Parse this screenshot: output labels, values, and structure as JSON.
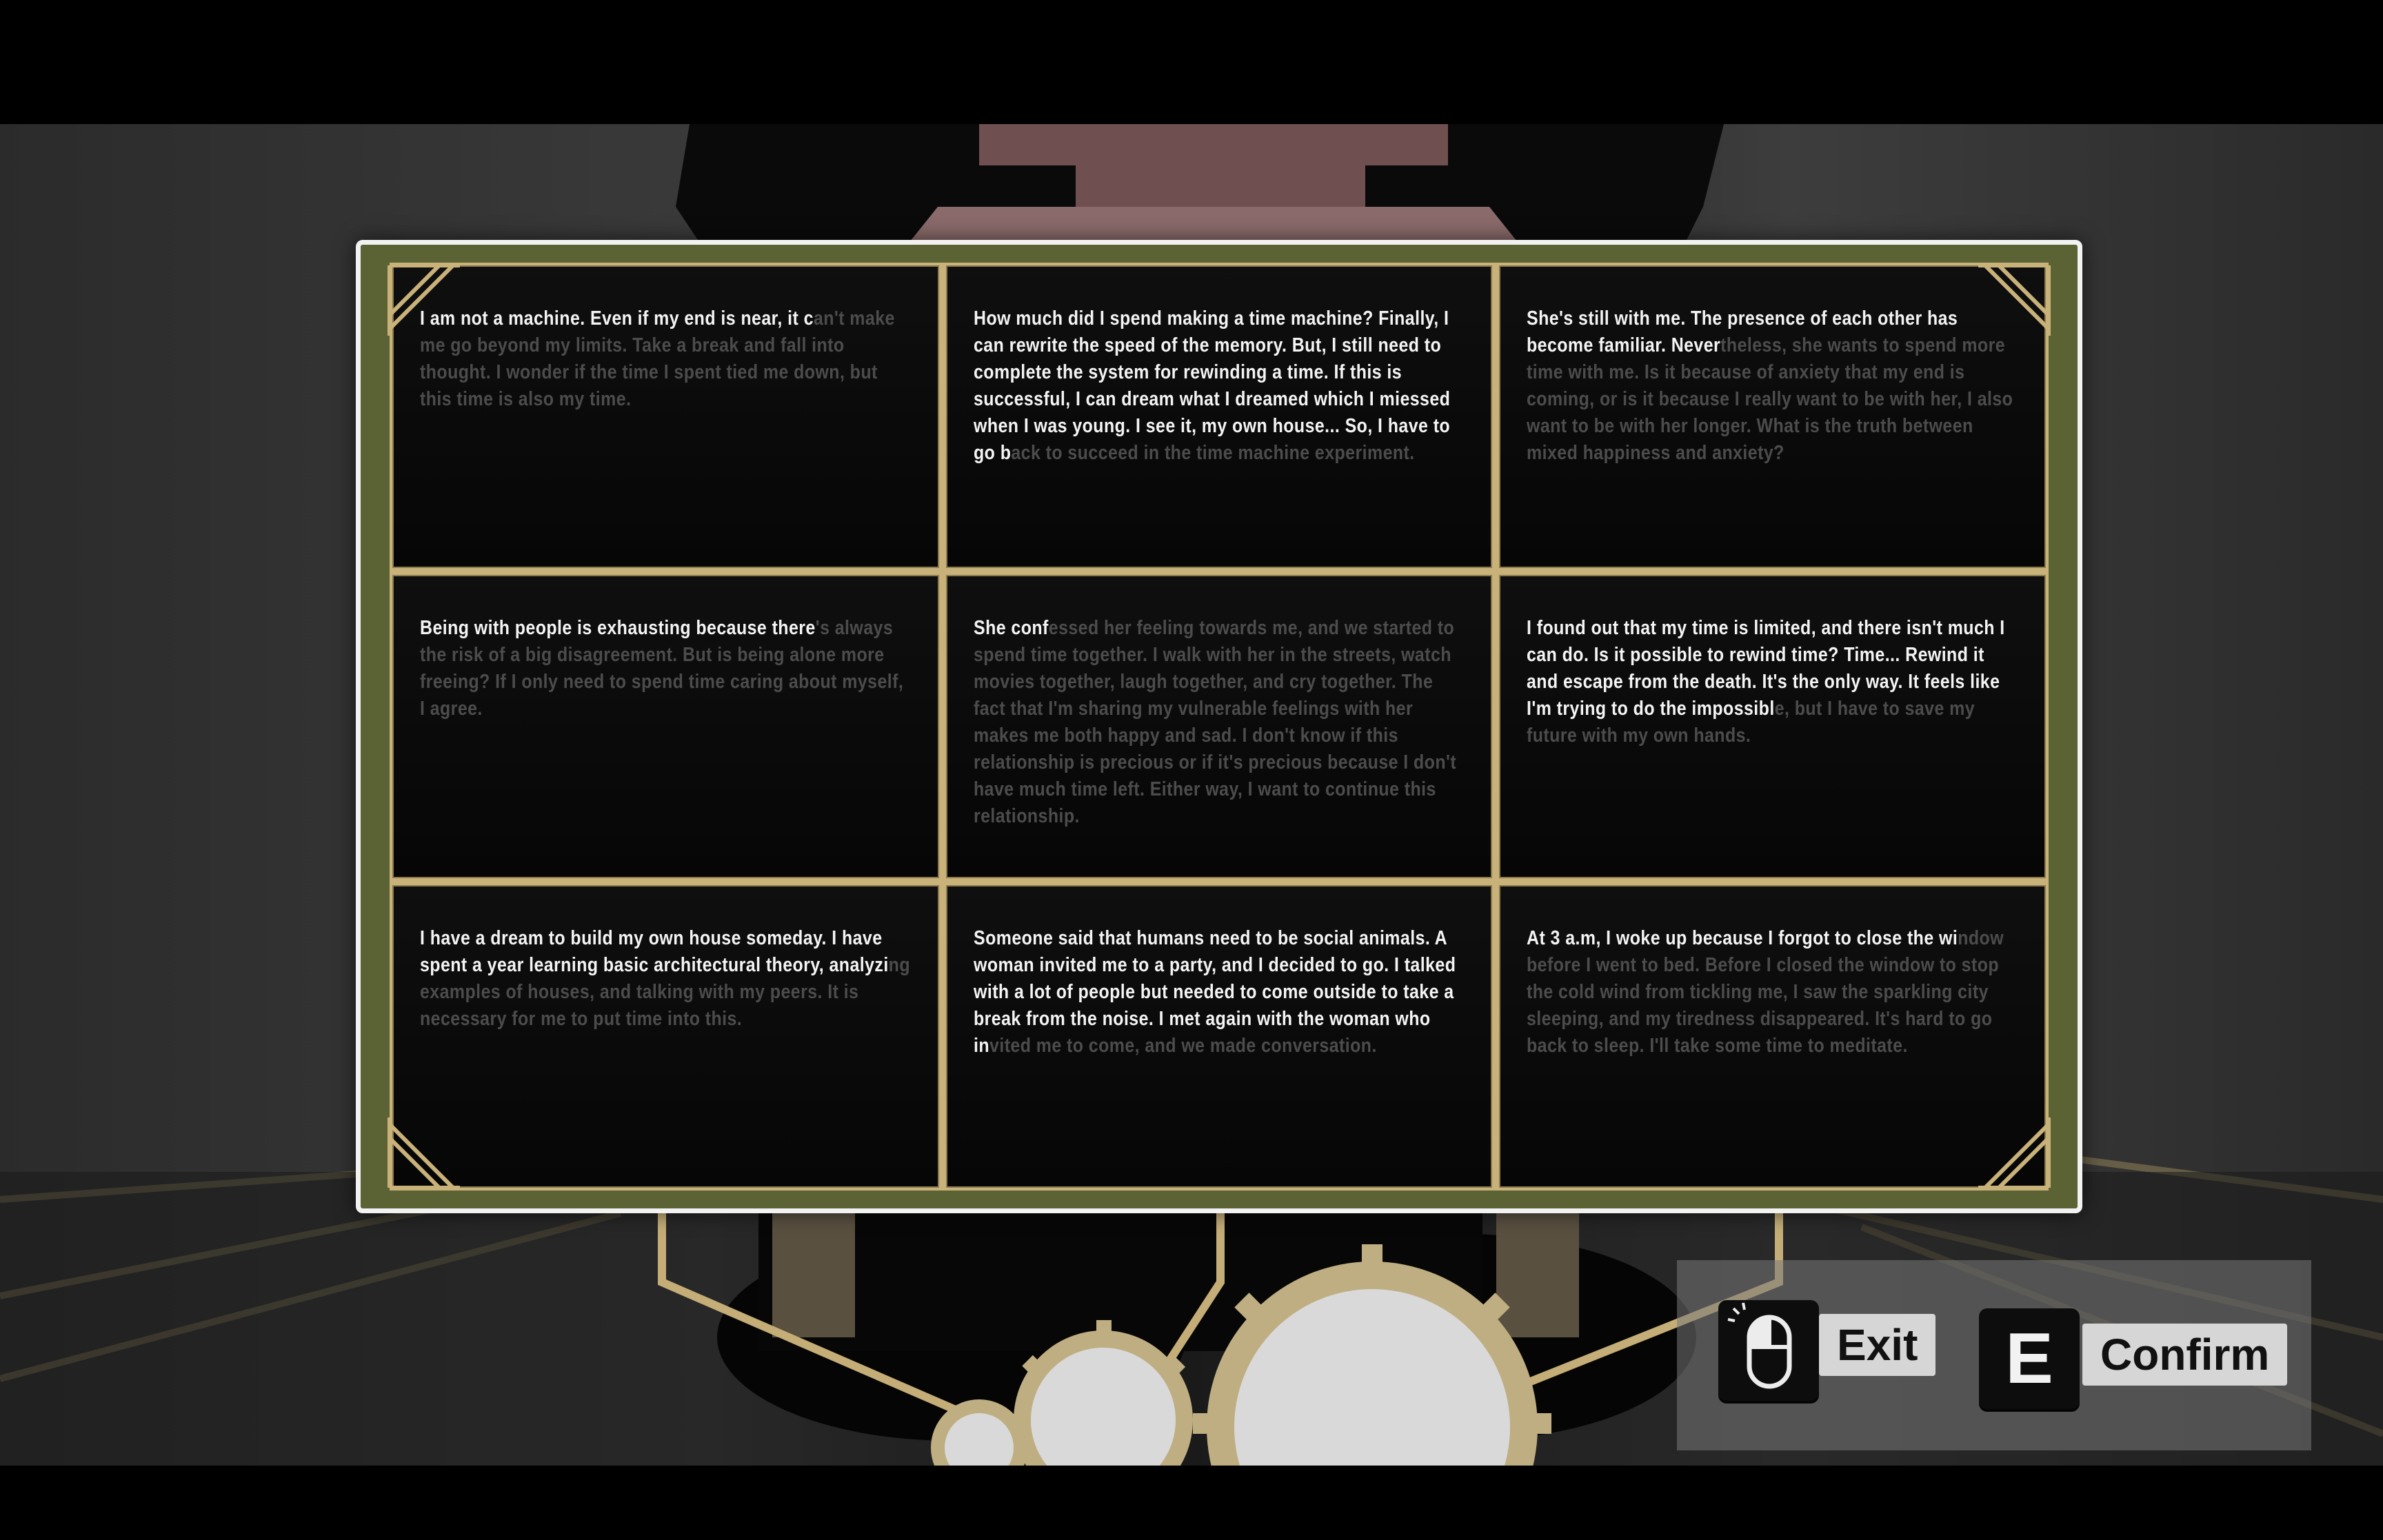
{
  "board": {
    "cards": [
      {
        "bright": "I am not a machine. Even if my end is near, it c",
        "dim": "an't make me go beyond my limits. Take a break and fall into thought. I wonder if the time I spent tied me down, but this time is also my time."
      },
      {
        "bright": "How much did I spend making a time machine? Finally, I can rewrite the speed of the memory. But, I still need to complete the system for rewinding a time. If this is successful, I can dream what I dreamed which I miessed when I was young. I see it, my own house... So, I have to go b",
        "dim": "ack to succeed in the time machine experiment."
      },
      {
        "bright": "She's still with me. The presence of each other has become familiar. Never",
        "dim": "theless, she wants to spend more time with me. Is it because of anxiety that my end is coming, or is it because I really want to be with her, I also want to be with her longer. What is the truth between mixed happiness and anxiety?"
      },
      {
        "bright": "Being with people is exhausting because there",
        "dim": "'s always the risk of a big disagreement. But is being alone more freeing?  If I only need to spend time caring about myself, I agree."
      },
      {
        "bright": "She conf",
        "dim": "essed her feeling towards me, and we started to spend time together. I walk with her in the streets, watch movies together, laugh together, and cry together. The fact that I'm sharing my vulnerable feelings with her makes me both happy and sad. I don't know if this relationship is precious or if it's precious because I don't have much time left. Either way, I want to continue this relationship."
      },
      {
        "bright": "I found out that my time is limited, and there isn't much I can do. Is it possible to rewind time? Time... Rewind it and escape from the death. It's the only way. It feels like I'm trying to do the impossibl",
        "dim": "e, but I have to save my future with my own hands."
      },
      {
        "bright": "I have a dream to build my own house someday. I have spent a year learning basic architectural theory, analyzi",
        "dim": "ng examples of houses, and talking with my peers. It is necessary for me to put time into this."
      },
      {
        "bright": "Someone said that humans need to be social animals. A woman invited me to a party, and I decided to go. I talked with a lot of people but needed to come outside to take a break from the noise. I met again with the woman who in",
        "dim": "vited me to come, and we made conversation."
      },
      {
        "bright": "At 3 a.m, I woke up because I forgot to close the wi",
        "dim": "ndow before I went to bed. Before I closed the window to stop the cold wind from tickling me, I saw the sparkling city sleeping, and my tiredness disappeared.  It's hard to go back to sleep. I'll take some time to meditate."
      }
    ]
  },
  "controls": {
    "exit": {
      "label": "Exit",
      "icon": "mouse-icon"
    },
    "confirm": {
      "label": "Confirm",
      "key": "E"
    }
  },
  "colors": {
    "frame_green": "#5b6233",
    "gold_divider": "#c9b27a",
    "text_bright": "#f4f4f4",
    "text_dim": "#4c4c4c"
  }
}
